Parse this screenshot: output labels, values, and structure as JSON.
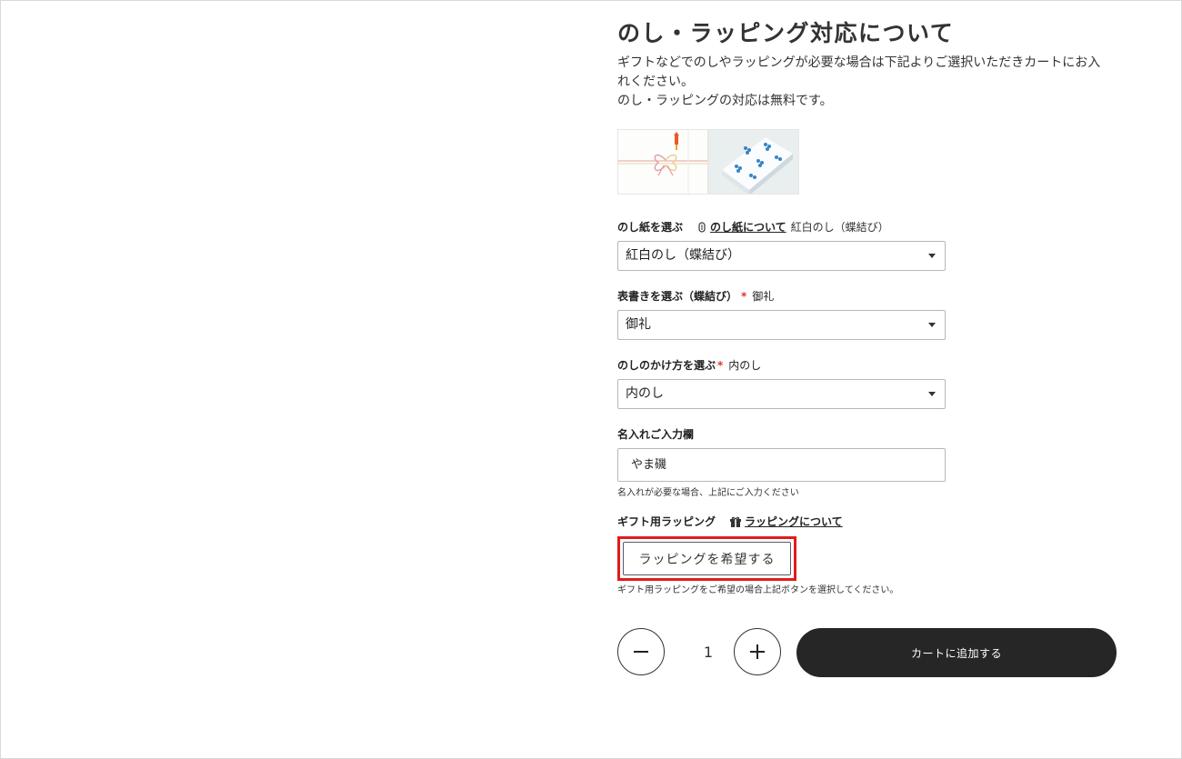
{
  "section": {
    "title": "のし・ラッピング対応について",
    "desc_line1": "ギフトなどでのしやラッピングが必要な場合は下記よりご選択いただきカートにお入れください。",
    "desc_line2": "のし・ラッピングの対応は無料です。"
  },
  "noshi_paper": {
    "label": "のし紙を選ぶ",
    "link": "のし紙について",
    "current": "紅白のし（蝶結び）",
    "selected": "紅白のし（蝶結び）"
  },
  "omotegaki": {
    "label": "表書きを選ぶ（蝶結び）",
    "required_mark": "*",
    "current": "御礼",
    "selected": "御礼"
  },
  "noshi_method": {
    "label": "のしのかけ方を選ぶ",
    "required_mark": "*",
    "current": "内のし",
    "selected": "内のし"
  },
  "name_entry": {
    "label": "名入れご入力欄",
    "value": "やま磯",
    "hint": "名入れが必要な場合、上記にご入力ください"
  },
  "wrapping": {
    "label": "ギフト用ラッピング",
    "link": "ラッピングについて",
    "button": "ラッピングを希望する",
    "hint": "ギフト用ラッピングをご希望の場合上記ボタンを選択してください。"
  },
  "cart": {
    "quantity": "1",
    "add_button": "カートに追加する"
  },
  "colors": {
    "required": "#e03030",
    "highlight": "#e21b1b",
    "cart_button": "#262626"
  }
}
